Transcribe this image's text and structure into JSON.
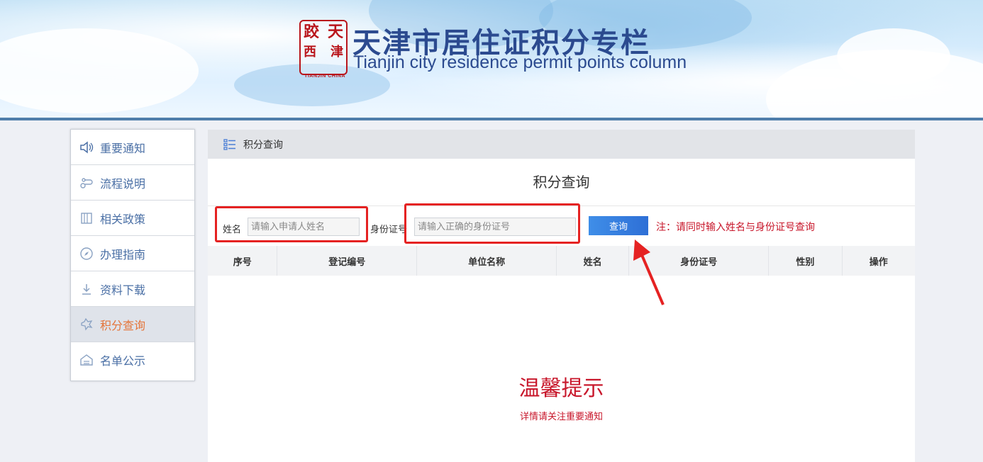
{
  "banner": {
    "title_cn": "天津市居住证积分专栏",
    "title_en": "Tianjin city residence permit points column",
    "seal_chars": [
      "天",
      "津",
      "跤",
      "西"
    ],
    "seal_caption": "TIANJIN CHINA"
  },
  "sidebar": {
    "items": [
      {
        "label": "重要通知",
        "icon": "speaker-icon"
      },
      {
        "label": "流程说明",
        "icon": "flow-icon"
      },
      {
        "label": "相关政策",
        "icon": "book-icon"
      },
      {
        "label": "办理指南",
        "icon": "compass-icon"
      },
      {
        "label": "资料下载",
        "icon": "download-icon"
      },
      {
        "label": "积分查询",
        "icon": "search-points-icon",
        "active": true
      },
      {
        "label": "名单公示",
        "icon": "list-board-icon"
      }
    ]
  },
  "panel": {
    "header": "积分查询",
    "title": "积分查询",
    "form": {
      "name_label": "姓名",
      "name_placeholder": "请输入申请人姓名",
      "id_label": "身份证号",
      "id_placeholder": "请输入正确的身份证号",
      "query_button": "查询",
      "note": "注：请同时输入姓名与身份证号查询"
    },
    "table": {
      "columns": [
        "序号",
        "登记编号",
        "单位名称",
        "姓名",
        "身份证号",
        "性别",
        "操作"
      ]
    },
    "tips": {
      "title": "温馨提示",
      "subtitle": "详情请关注重要通知"
    }
  },
  "colors": {
    "accent_red": "#c8172b",
    "highlight_red": "#e52222",
    "brand_blue": "#2b4a8f",
    "sidebar_text": "#4a6fa5",
    "active_text": "#e4753a",
    "button_blue": "#2e6fd6"
  }
}
